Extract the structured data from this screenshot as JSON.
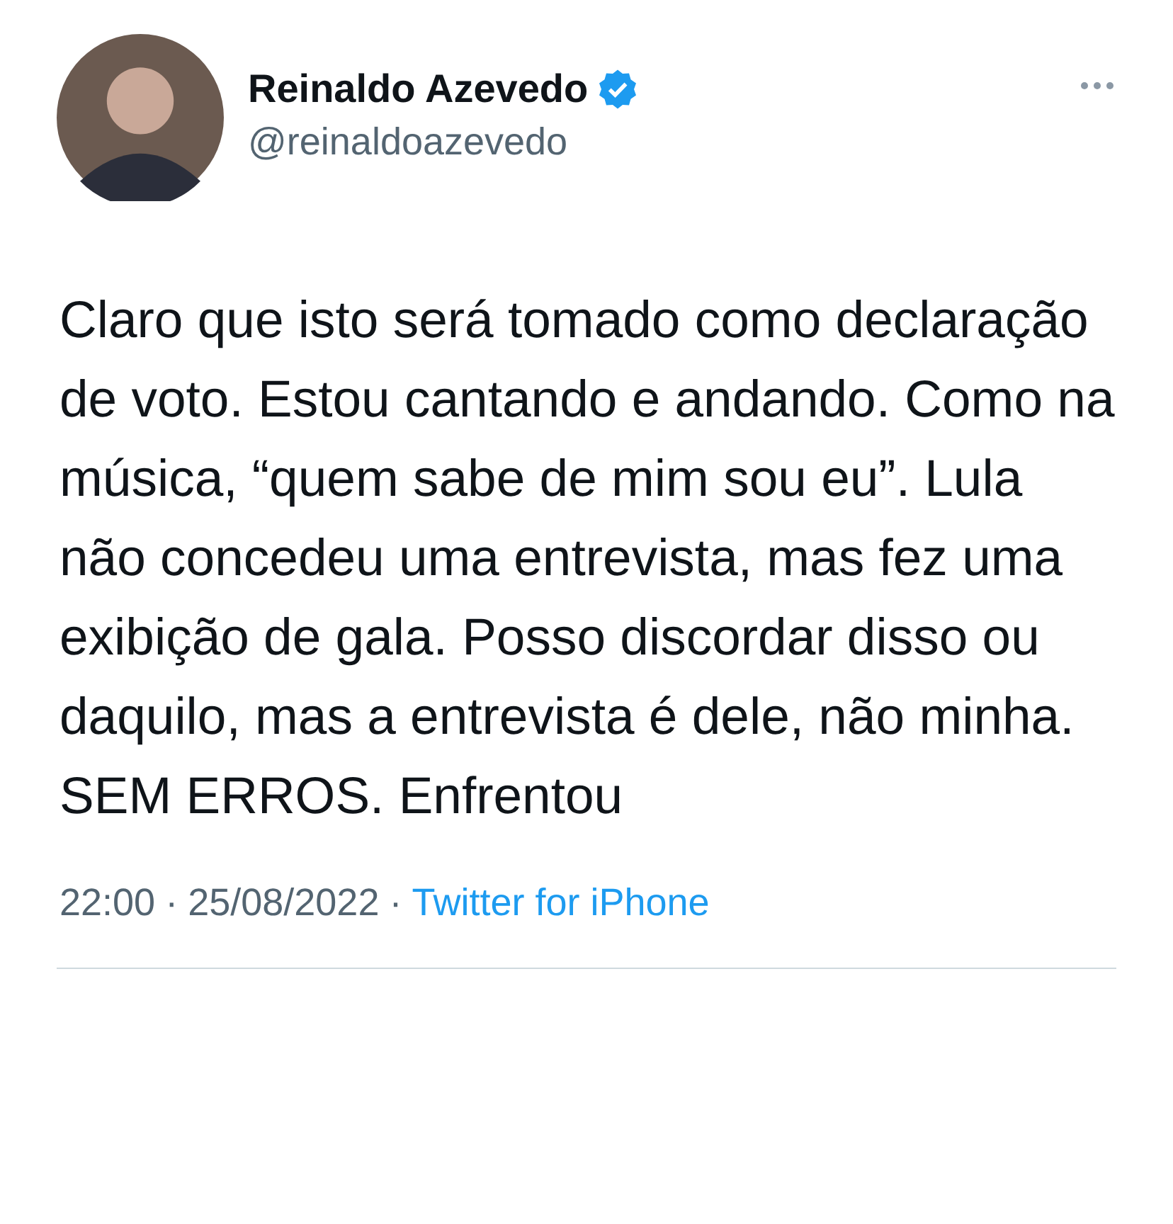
{
  "author": {
    "name": "Reinaldo Azevedo",
    "verified": true,
    "handle": "@reinaldoazevedo"
  },
  "tweet": {
    "text": "Claro que isto será tomado como declaração de voto. Estou cantando e andando. Como na música, “quem sabe de mim sou eu”. Lula não concedeu uma entrevista, mas fez uma exibição de gala. Posso discordar disso ou daquilo, mas a entrevista é dele, não minha. SEM ERROS. Enfrentou"
  },
  "meta": {
    "time": "22:00",
    "separator_1": "·",
    "date": "25/08/2022",
    "separator_2": "·",
    "source": "Twitter for iPhone"
  }
}
